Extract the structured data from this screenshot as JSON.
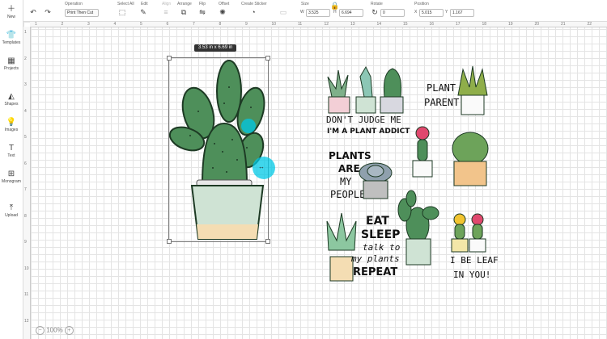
{
  "toolbar": {
    "undo_icon": "undo-icon",
    "redo_icon": "redo-icon",
    "operation": {
      "label": "Operation",
      "value": "Print Then Cut"
    },
    "select_all": {
      "label": "Select All"
    },
    "edit": {
      "label": "Edit"
    },
    "align": {
      "label": "Align"
    },
    "arrange": {
      "label": "Arrange"
    },
    "flip": {
      "label": "Flip"
    },
    "offset": {
      "label": "Offset"
    },
    "create_sticker": {
      "label": "Create Sticker"
    },
    "size": {
      "label": "Size",
      "w_label": "W",
      "w_value": "3.525",
      "h_label": "H",
      "h_value": "6.694"
    },
    "rotate": {
      "label": "Rotate",
      "value": "0"
    },
    "position": {
      "label": "Position",
      "x_label": "X",
      "x_value": "5.015",
      "y_label": "Y",
      "y_value": "1.167"
    }
  },
  "sidebar": {
    "items": [
      {
        "label": "New",
        "icon": "plus-icon"
      },
      {
        "label": "Templates",
        "icon": "shirt-icon"
      },
      {
        "label": "Projects",
        "icon": "projects-icon"
      },
      {
        "label": "Shapes",
        "icon": "shapes-icon"
      },
      {
        "label": "Images",
        "icon": "lightbulb-icon"
      },
      {
        "label": "Text",
        "icon": "text-icon"
      },
      {
        "label": "Monogram",
        "icon": "monogram-icon"
      },
      {
        "label": "Upload",
        "icon": "upload-icon"
      }
    ]
  },
  "ruler": {
    "top": [
      "1",
      "2",
      "3",
      "4",
      "5",
      "6",
      "7",
      "8",
      "9",
      "10",
      "11",
      "12",
      "13",
      "14",
      "15",
      "16",
      "17",
      "18",
      "19",
      "20",
      "21",
      "22",
      "23"
    ],
    "left": [
      "1",
      "2",
      "3",
      "4",
      "5",
      "6",
      "7",
      "8",
      "9",
      "10",
      "11",
      "12"
    ]
  },
  "canvas": {
    "dimension_tooltip": "3.53 in x 6.69 in",
    "zoom": "100%"
  },
  "stickers": {
    "plant_parent": [
      "PLANT",
      "PARENT"
    ],
    "dont_judge": "DON'T JUDGE ME",
    "plant_addict": "I'M A PLANT ADDICT",
    "plants_are": [
      "PLANTS",
      "ARE",
      "MY",
      "PEOPLE"
    ],
    "eat_sleep": [
      "EAT",
      "SLEEP",
      "talk to",
      "my plants",
      "REPEAT"
    ],
    "be_leaf": [
      "I BE LEAF",
      "IN YOU!"
    ]
  },
  "colors": {
    "cactus": "#4e8f5a",
    "cactus_dark": "#2f6a3c",
    "pot": "#cfe3d4",
    "selection": "#00c8e6"
  }
}
